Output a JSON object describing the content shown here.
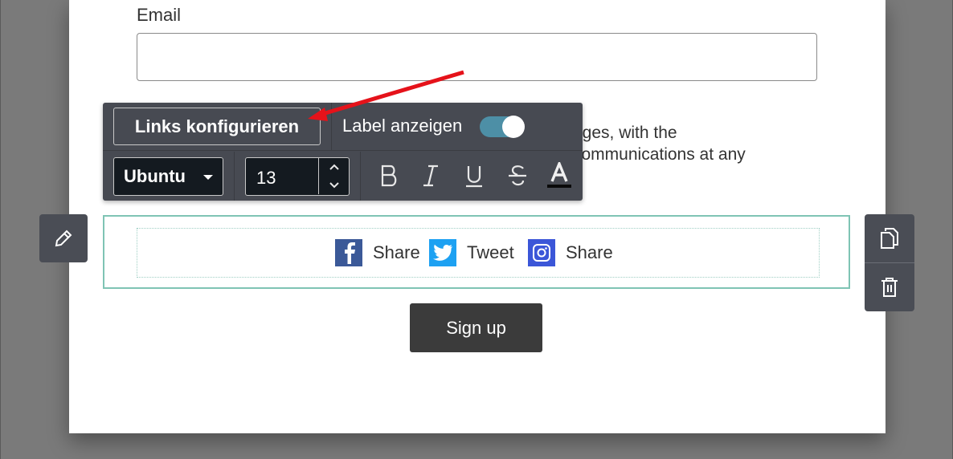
{
  "form": {
    "email_label": "Email",
    "email_value": "",
    "consent_line1": "ages, with the",
    "consent_line2": "communications at any"
  },
  "toolbar": {
    "links_button": "Links konfigurieren",
    "label_toggle_text": "Label anzeigen",
    "label_toggle_on": true,
    "font_family": "Ubuntu",
    "font_size": "13",
    "format_buttons": [
      "B",
      "I",
      "U",
      "S",
      "A"
    ]
  },
  "share": {
    "items": [
      {
        "network": "facebook",
        "icon": "facebook-icon",
        "label": "Share",
        "color": "#3b5998"
      },
      {
        "network": "twitter",
        "icon": "twitter-icon",
        "label": "Tweet",
        "color": "#1da1f2"
      },
      {
        "network": "instagram",
        "icon": "instagram-icon",
        "label": "Share",
        "color": "#3b56d8"
      }
    ]
  },
  "signup_button": "Sign up",
  "colors": {
    "toolbar_bg": "#474a52",
    "toggle_on": "#4d8fa6",
    "selection_border": "#7fc4b4",
    "annotation_arrow": "#e5121a"
  }
}
